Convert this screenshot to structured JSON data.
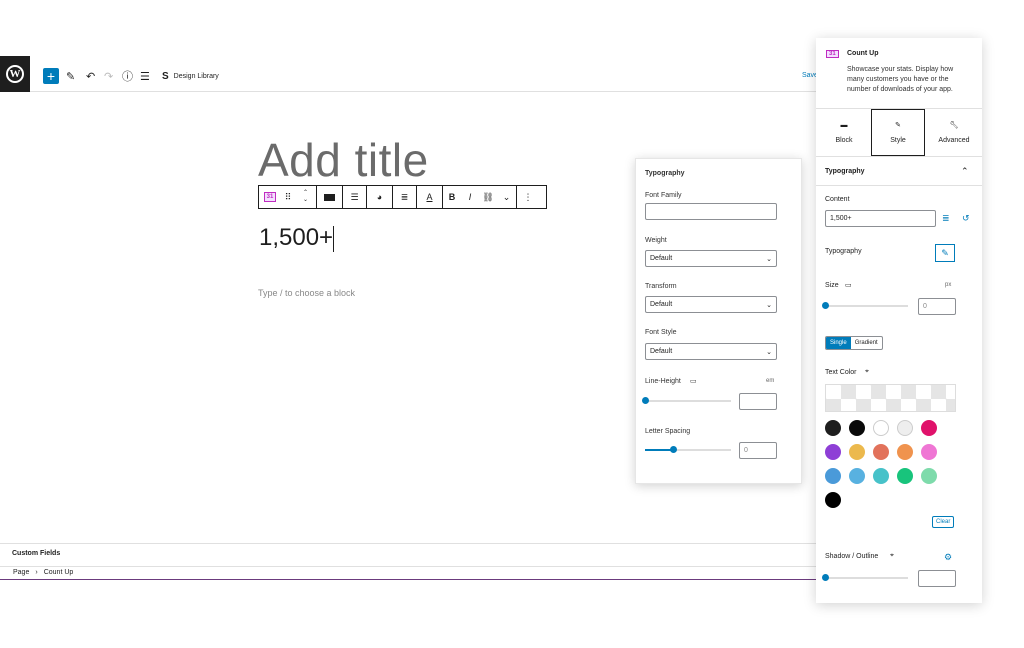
{
  "toolbar": {
    "add_block": "+",
    "edit": "✎",
    "undo": "↶",
    "redo": "↷",
    "info": "ⓘ",
    "list_view": "☰",
    "design_library_label": "Design Library",
    "save_label": "Save"
  },
  "editor": {
    "title_placeholder": "Add title",
    "count_value": "1,500+",
    "block_hint": "Type / to choose a block",
    "block_toolbar": {
      "block_type_icon": "31",
      "bold": "B",
      "italic": "I"
    }
  },
  "footer": {
    "custom_fields": "Custom Fields",
    "breadcrumb": [
      "Page",
      "Count Up"
    ]
  },
  "typography_popover": {
    "title": "Typography",
    "font_family_label": "Font Family",
    "font_family_value": "",
    "weight_label": "Weight",
    "weight_value": "Default",
    "transform_label": "Transform",
    "transform_value": "Default",
    "font_style_label": "Font Style",
    "font_style_value": "Default",
    "line_height_label": "Line-Height",
    "line_height_unit": "em",
    "line_height_value": "",
    "line_height_level": 0.0,
    "letter_spacing_label": "Letter Spacing",
    "letter_spacing_value": "0",
    "letter_spacing_level": 0.33
  },
  "sidebar": {
    "block_icon": "31",
    "block_name": "Count Up",
    "block_description": "Showcase your stats. Display how many customers you have or the number of downloads of your app.",
    "tabs": [
      {
        "label": "Block"
      },
      {
        "label": "Style"
      },
      {
        "label": "Advanced"
      }
    ],
    "panel_title": "Typography",
    "content_label": "Content",
    "content_value": "1,500+",
    "typography_label": "Typography",
    "size_label": "Size",
    "size_unit": "px",
    "size_value": "0",
    "size_level": 0.0,
    "single_label": "Single",
    "gradient_label": "Gradient",
    "text_color_label": "Text Color",
    "clear_label": "Clear",
    "shadow_label": "Shadow / Outline",
    "shadow_value": "",
    "shadow_level": 0.0,
    "accent_color": "#007cba",
    "swatches": [
      "#1e1e1e",
      "#0a0a0a",
      "#ffffff",
      "#eeeeee",
      "#e0126b",
      "#8e3fd6",
      "#ecb94d",
      "#e2725b",
      "#f0934e",
      "#ef76d4",
      "#4a9ad9",
      "#58b1e0",
      "#47c2c9",
      "#18c47c",
      "#7edbab",
      "#000000"
    ]
  }
}
